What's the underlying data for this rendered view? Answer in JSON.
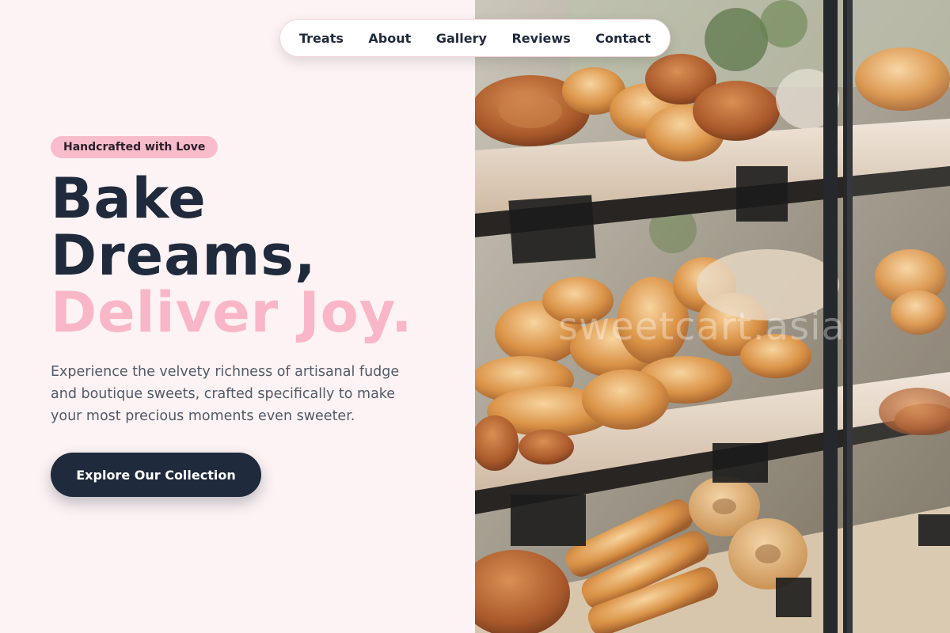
{
  "nav": {
    "items": [
      {
        "label": "Treats"
      },
      {
        "label": "About"
      },
      {
        "label": "Gallery"
      },
      {
        "label": "Reviews"
      },
      {
        "label": "Contact"
      }
    ]
  },
  "hero": {
    "badge": "Handcrafted with Love",
    "headline_line1": "Bake",
    "headline_line2": "Dreams,",
    "headline_line3": "Deliver Joy.",
    "description": "Experience the velvety richness of artisanal fudge and boutique sweets, crafted specifically to make your most precious moments even sweeter.",
    "cta_label": "Explore Our Collection"
  },
  "image": {
    "alt": "Bakery display case with pastries and breads",
    "watermark": "sweetcart.asia"
  },
  "colors": {
    "background": "#fdf3f4",
    "primary": "#1f2a3c",
    "accent_pink": "#f9b6c6",
    "badge_bg": "#f9bccb"
  }
}
